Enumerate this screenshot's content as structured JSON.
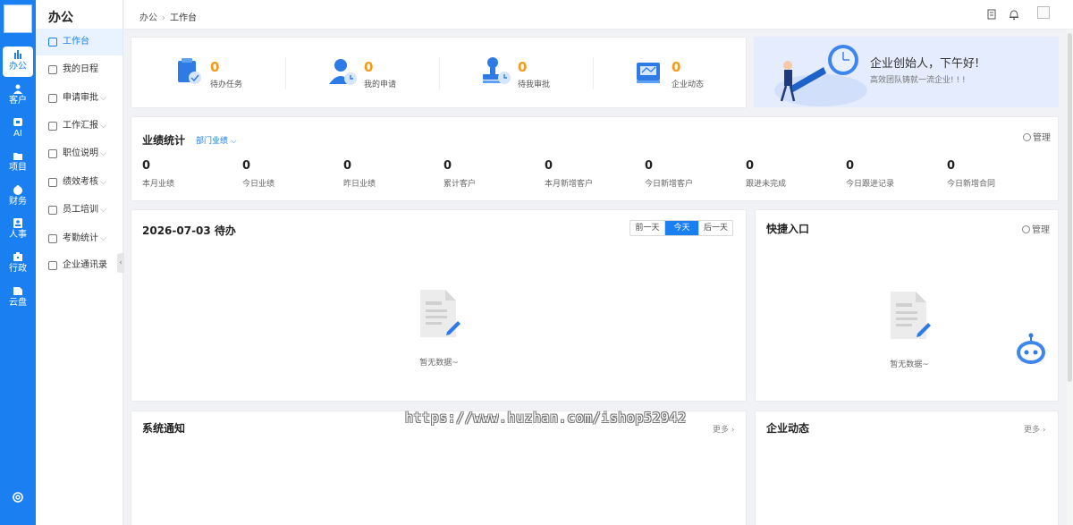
{
  "rail": {
    "items": [
      {
        "label": "办公",
        "icon": "office-icon",
        "active": true
      },
      {
        "label": "客户",
        "icon": "customer-icon"
      },
      {
        "label": "AI",
        "icon": "ai-icon"
      },
      {
        "label": "项目",
        "icon": "project-icon"
      },
      {
        "label": "财务",
        "icon": "finance-icon"
      },
      {
        "label": "人事",
        "icon": "hr-icon"
      },
      {
        "label": "行政",
        "icon": "admin-icon"
      },
      {
        "label": "云盘",
        "icon": "cloud-disk-icon"
      }
    ]
  },
  "submenu": {
    "title": "办公",
    "items": [
      {
        "label": "工作台",
        "active": true
      },
      {
        "label": "我的日程"
      },
      {
        "label": "申请审批",
        "expandable": true
      },
      {
        "label": "工作汇报",
        "expandable": true
      },
      {
        "label": "职位说明",
        "expandable": true
      },
      {
        "label": "绩效考核",
        "expandable": true
      },
      {
        "label": "员工培训",
        "expandable": true
      },
      {
        "label": "考勤统计",
        "expandable": true
      },
      {
        "label": "企业通讯录"
      }
    ],
    "caret": "⌵"
  },
  "header": {
    "breadcrumb": [
      "办公",
      "工作台"
    ],
    "separator": "›"
  },
  "quick_stats": [
    {
      "value": "0",
      "label": "待办任务"
    },
    {
      "value": "0",
      "label": "我的申请"
    },
    {
      "value": "0",
      "label": "待我审批"
    },
    {
      "value": "0",
      "label": "企业动态"
    }
  ],
  "banner": {
    "greeting": "企业创始人，下午好!",
    "subtitle": "高效团队铸就一流企业! ! !"
  },
  "performance": {
    "title": "业绩统计",
    "scope_select": "部门业绩",
    "manage": "管理",
    "stats": [
      {
        "value": "0",
        "label": "本月业绩"
      },
      {
        "value": "0",
        "label": "今日业绩"
      },
      {
        "value": "0",
        "label": "昨日业绩"
      },
      {
        "value": "0",
        "label": "累计客户"
      },
      {
        "value": "0",
        "label": "本月新增客户"
      },
      {
        "value": "0",
        "label": "今日新增客户"
      },
      {
        "value": "0",
        "label": "跟进未完成"
      },
      {
        "value": "0",
        "label": "今日跟进记录"
      },
      {
        "value": "0",
        "label": "今日新增合同"
      }
    ]
  },
  "todo": {
    "title": "2026-07-03 待办",
    "days": [
      "前一天",
      "今天",
      "后一天"
    ],
    "empty": "暂无数据~"
  },
  "shortcuts": {
    "title": "快捷入口",
    "manage": "管理",
    "empty": "暂无数据~"
  },
  "notices": {
    "title": "系统通知",
    "more": "更多 ›"
  },
  "news": {
    "title": "企业动态",
    "more": "更多 ›"
  },
  "watermark": "https://www.huzhan.com/ishop52942",
  "colors": {
    "primary": "#1a7ff0",
    "accent_number": "#f59a1b"
  }
}
